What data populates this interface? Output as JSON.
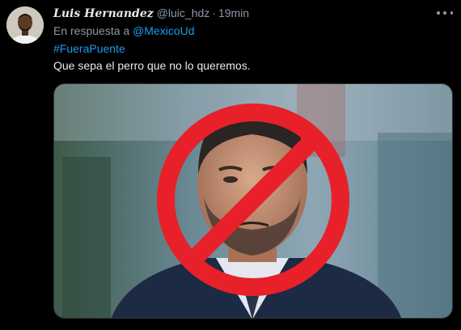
{
  "tweet": {
    "display_name": "Luis Hernandez",
    "handle": "@luic_hdz",
    "separator": "·",
    "time": "19min",
    "reply_prefix": "En respuesta a",
    "reply_mention": "@MexicoUd",
    "hashtag": "#FueraPuente",
    "text": "Que sepa el perro que no lo queremos.",
    "more_icon": "more-horizontal-icon"
  },
  "colors": {
    "background": "#000000",
    "text": "#e7e9ea",
    "muted": "#8b98a5",
    "link": "#1d9bf0",
    "prohibition_sign": "#e8202a"
  }
}
